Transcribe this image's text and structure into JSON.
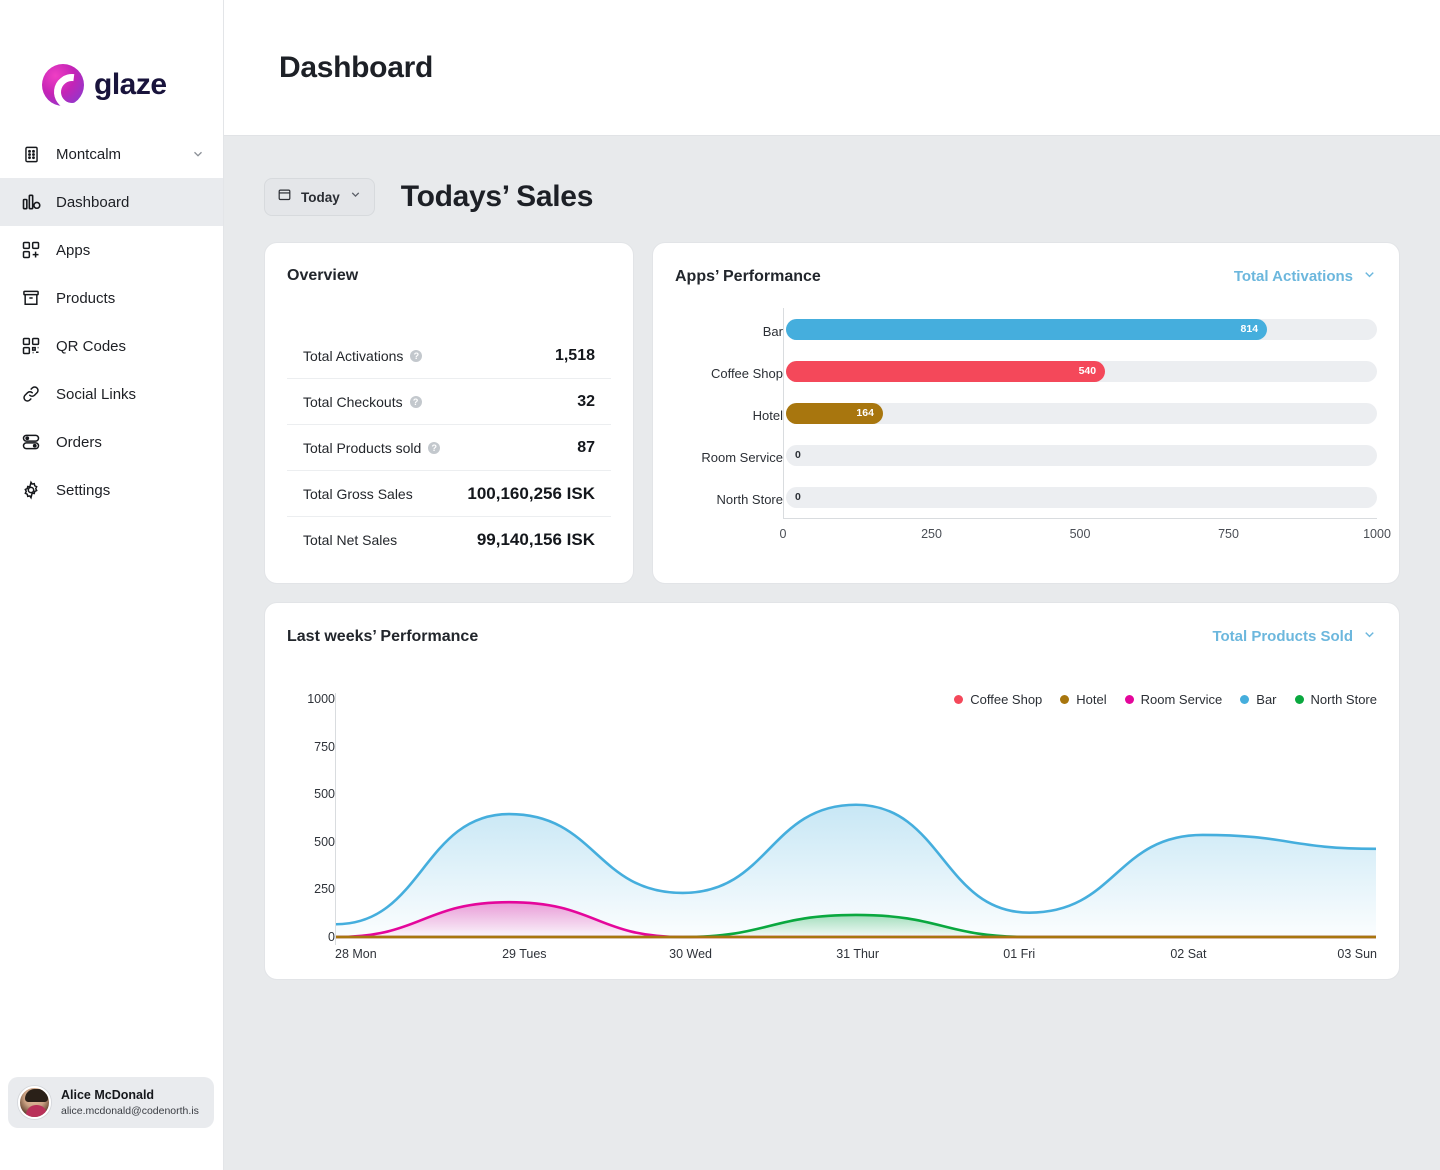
{
  "brand": {
    "name": "glaze",
    "logo_icon": "glaze-logo-icon"
  },
  "sidebar": {
    "workspace": {
      "label": "Montcalm",
      "icon": "building-icon",
      "chevron": "chevron-down-icon"
    },
    "items": [
      {
        "label": "Dashboard",
        "icon": "bar-chart-icon",
        "active": true
      },
      {
        "label": "Apps",
        "icon": "apps-grid-plus-icon",
        "active": false
      },
      {
        "label": "Products",
        "icon": "box-icon",
        "active": false
      },
      {
        "label": "QR Codes",
        "icon": "qr-code-icon",
        "active": false
      },
      {
        "label": "Social Links",
        "icon": "link-icon",
        "active": false
      },
      {
        "label": "Orders",
        "icon": "toggles-icon",
        "active": false
      },
      {
        "label": "Settings",
        "icon": "gear-icon",
        "active": false
      }
    ],
    "user": {
      "name": "Alice McDonald",
      "email": "alice.mcdonald@codenorth.is",
      "avatar_icon": "avatar"
    }
  },
  "header": {
    "title": "Dashboard"
  },
  "toolbar": {
    "date_filter": {
      "label": "Today",
      "icon": "calendar-icon",
      "chevron": "chevron-down-icon"
    },
    "section_title": "Todays’ Sales"
  },
  "overview": {
    "title": "Overview",
    "rows": [
      {
        "label": "Total Activations",
        "value": "1,518",
        "has_info": true
      },
      {
        "label": "Total Checkouts",
        "value": "32",
        "has_info": true
      },
      {
        "label": "Total Products sold",
        "value": "87",
        "has_info": true
      },
      {
        "label": "Total Gross Sales",
        "value": "100,160,256 ISK",
        "has_info": false
      },
      {
        "label": "Total Net Sales",
        "value": "99,140,156 ISK",
        "has_info": false
      }
    ]
  },
  "apps_performance": {
    "title": "Apps’ Performance",
    "metric_select": {
      "label": "Total Activations",
      "chevron": "chevron-down-icon"
    }
  },
  "last_week": {
    "title": "Last weeks’ Performance",
    "metric_select": {
      "label": "Total Products Sold",
      "chevron": "chevron-down-icon"
    }
  },
  "colors": {
    "coffee_shop": "#f4485a",
    "hotel": "#a8760e",
    "room_service": "#e4069b",
    "bar": "#45aedd",
    "north_store": "#0aa83f",
    "link": "#6cb7dd",
    "track": "#eceef1",
    "sidebar_active": "#e9ebee"
  },
  "chart_data": [
    {
      "type": "bar",
      "orientation": "horizontal",
      "title": "Apps’ Performance",
      "metric": "Total Activations",
      "categories": [
        "Bar",
        "Coffee Shop",
        "Hotel",
        "Room Service",
        "North Store"
      ],
      "values": [
        814,
        540,
        164,
        0,
        0
      ],
      "colors": [
        "#45aedd",
        "#f4485a",
        "#a8760e",
        "#e4069b",
        "#0aa83f"
      ],
      "xlabel": "",
      "ylabel": "",
      "xlim": [
        0,
        1000
      ],
      "xticks": [
        0,
        250,
        500,
        750,
        1000
      ],
      "grid": false,
      "legend": "none",
      "data_labels": [
        "814",
        "540",
        "164",
        "0",
        "0"
      ]
    },
    {
      "type": "area",
      "title": "Last weeks’ Performance",
      "metric": "Total Products Sold",
      "x": [
        "28 Mon",
        "29 Tues",
        "30 Wed",
        "31 Thur",
        "01 Fri",
        "02 Sat",
        "03 Sun"
      ],
      "ylim": [
        0,
        1000
      ],
      "yticks": [
        "1000",
        "750",
        "500",
        "500",
        "250",
        "0"
      ],
      "grid": false,
      "legend": "top-right",
      "series": [
        {
          "name": "Coffee Shop",
          "color": "#f4485a",
          "values": [
            0,
            0,
            0,
            0,
            0,
            0,
            0
          ]
        },
        {
          "name": "Hotel",
          "color": "#a8760e",
          "values": [
            0,
            0,
            0,
            0,
            0,
            0,
            0
          ]
        },
        {
          "name": "Room Service",
          "color": "#e4069b",
          "values": [
            0,
            150,
            0,
            0,
            0,
            0,
            0
          ]
        },
        {
          "name": "Bar",
          "color": "#45aedd",
          "values": [
            55,
            530,
            190,
            570,
            105,
            440,
            380
          ]
        },
        {
          "name": "North Store",
          "color": "#0aa83f",
          "values": [
            0,
            0,
            0,
            95,
            0,
            0,
            0
          ]
        }
      ]
    }
  ]
}
